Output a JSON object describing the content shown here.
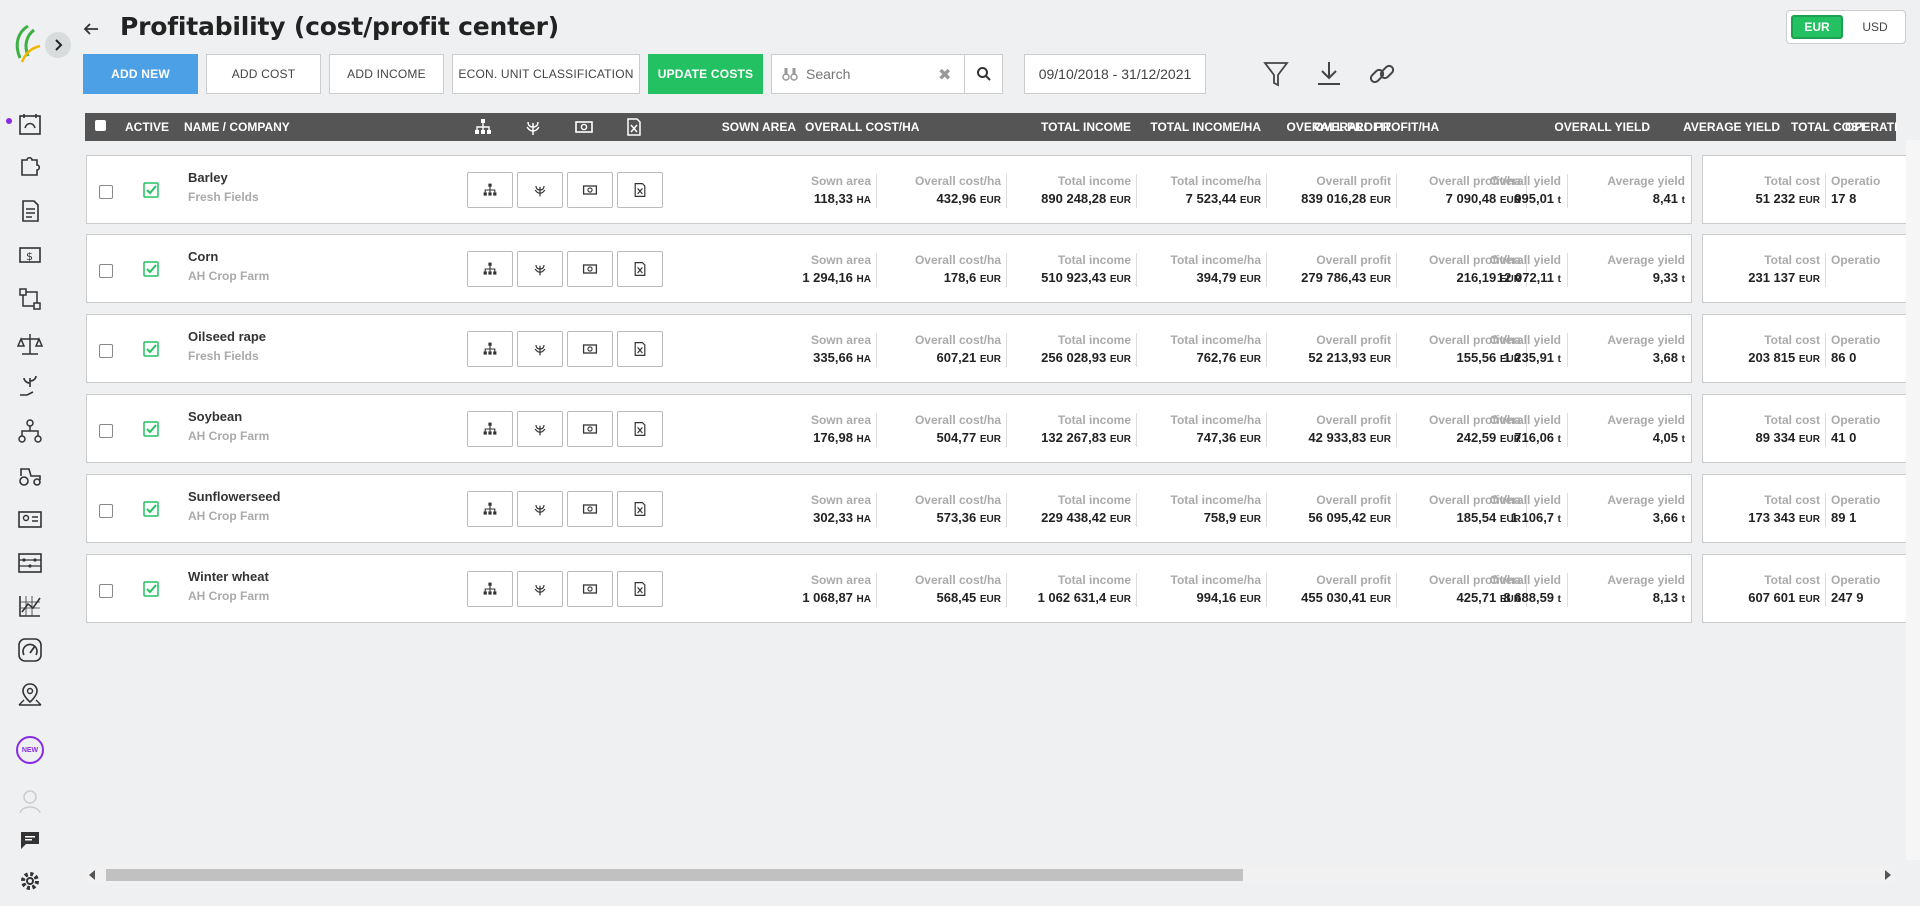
{
  "header": {
    "title": "Profitability (cost/profit center)"
  },
  "currency": {
    "options": [
      "EUR",
      "USD"
    ],
    "selected": "EUR"
  },
  "toolbar": {
    "add_new": "ADD NEW",
    "add_cost": "ADD COST",
    "add_income": "ADD INCOME",
    "econ_unit": "ECON. UNIT CLASSIFICATION",
    "update_costs": "UPDATE COSTS",
    "search_placeholder": "Search",
    "date_range": "09/10/2018 - 31/12/2021"
  },
  "sidebar": {
    "items": [
      "fields-icon",
      "puzzle-icon",
      "document-icon",
      "finance-icon",
      "flow-icon",
      "scale-icon",
      "plant-hand-icon",
      "hierarchy-icon",
      "tractor-icon",
      "id-card-icon",
      "abacus-icon",
      "chart-grid-icon",
      "gauge-icon",
      "map-pin-icon"
    ],
    "new_badge": "NEW"
  },
  "table": {
    "columns": {
      "active": "ACTIVE",
      "name": "NAME / COMPANY",
      "sown_area": "SOWN AREA",
      "overall_cost_ha": "OVERALL COST/HA",
      "total_income": "TOTAL INCOME",
      "total_income_ha": "TOTAL INCOME/HA",
      "overall_profit": "OVERALL PROFIT",
      "overall_profit_ha": "OVERALL PROFIT/HA",
      "overall_yield": "OVERALL YIELD",
      "average_yield": "AVERAGE YIELD",
      "total_cost": "TOTAL COST",
      "operation": "OPERATI"
    },
    "cell_labels": {
      "sown_area": "Sown area",
      "overall_cost_ha": "Overall cost/ha",
      "total_income": "Total income",
      "total_income_ha": "Total income/ha",
      "overall_profit": "Overall profit",
      "overall_profit_ha": "Overall profit/ha",
      "overall_yield": "Overall yield",
      "average_yield": "Average yield",
      "total_cost": "Total cost",
      "operation": "Operatio"
    },
    "units": {
      "ha": "HA",
      "eur": "EUR",
      "t": "t"
    },
    "rows": [
      {
        "name": "Barley",
        "company": "Fresh Fields",
        "active": true,
        "sown_area": "118,33",
        "overall_cost_ha": "432,96",
        "total_income": "890 248,28",
        "total_income_ha": "7 523,44",
        "overall_profit": "839 016,28",
        "overall_profit_ha": "7 090,48",
        "overall_yield": "995,01",
        "average_yield": "8,41",
        "total_cost": "51 232",
        "operation": "17 8"
      },
      {
        "name": "Corn",
        "company": "AH Crop Farm",
        "active": true,
        "sown_area": "1 294,16",
        "overall_cost_ha": "178,6",
        "total_income": "510 923,43",
        "total_income_ha": "394,79",
        "overall_profit": "279 786,43",
        "overall_profit_ha": "216,19",
        "overall_yield": "12 072,11",
        "average_yield": "9,33",
        "total_cost": "231 137",
        "operation": ""
      },
      {
        "name": "Oilseed rape",
        "company": "Fresh Fields",
        "active": true,
        "sown_area": "335,66",
        "overall_cost_ha": "607,21",
        "total_income": "256 028,93",
        "total_income_ha": "762,76",
        "overall_profit": "52 213,93",
        "overall_profit_ha": "155,56",
        "overall_yield": "1 235,91",
        "average_yield": "3,68",
        "total_cost": "203 815",
        "operation": "86 0"
      },
      {
        "name": "Soybean",
        "company": "AH Crop Farm",
        "active": true,
        "sown_area": "176,98",
        "overall_cost_ha": "504,77",
        "total_income": "132 267,83",
        "total_income_ha": "747,36",
        "overall_profit": "42 933,83",
        "overall_profit_ha": "242,59",
        "overall_yield": "716,06",
        "average_yield": "4,05",
        "total_cost": "89 334",
        "operation": "41 0"
      },
      {
        "name": "Sunflowerseed",
        "company": "AH Crop Farm",
        "active": true,
        "sown_area": "302,33",
        "overall_cost_ha": "573,36",
        "total_income": "229 438,42",
        "total_income_ha": "758,9",
        "overall_profit": "56 095,42",
        "overall_profit_ha": "185,54",
        "overall_yield": "1 106,7",
        "average_yield": "3,66",
        "total_cost": "173 343",
        "operation": "89 1"
      },
      {
        "name": "Winter wheat",
        "company": "AH Crop Farm",
        "active": true,
        "sown_area": "1 068,87",
        "overall_cost_ha": "568,45",
        "total_income": "1 062 631,4",
        "total_income_ha": "994,16",
        "overall_profit": "455 030,41",
        "overall_profit_ha": "425,71",
        "overall_yield": "8 688,59",
        "average_yield": "8,13",
        "total_cost": "607 601",
        "operation": "247 9"
      }
    ]
  }
}
